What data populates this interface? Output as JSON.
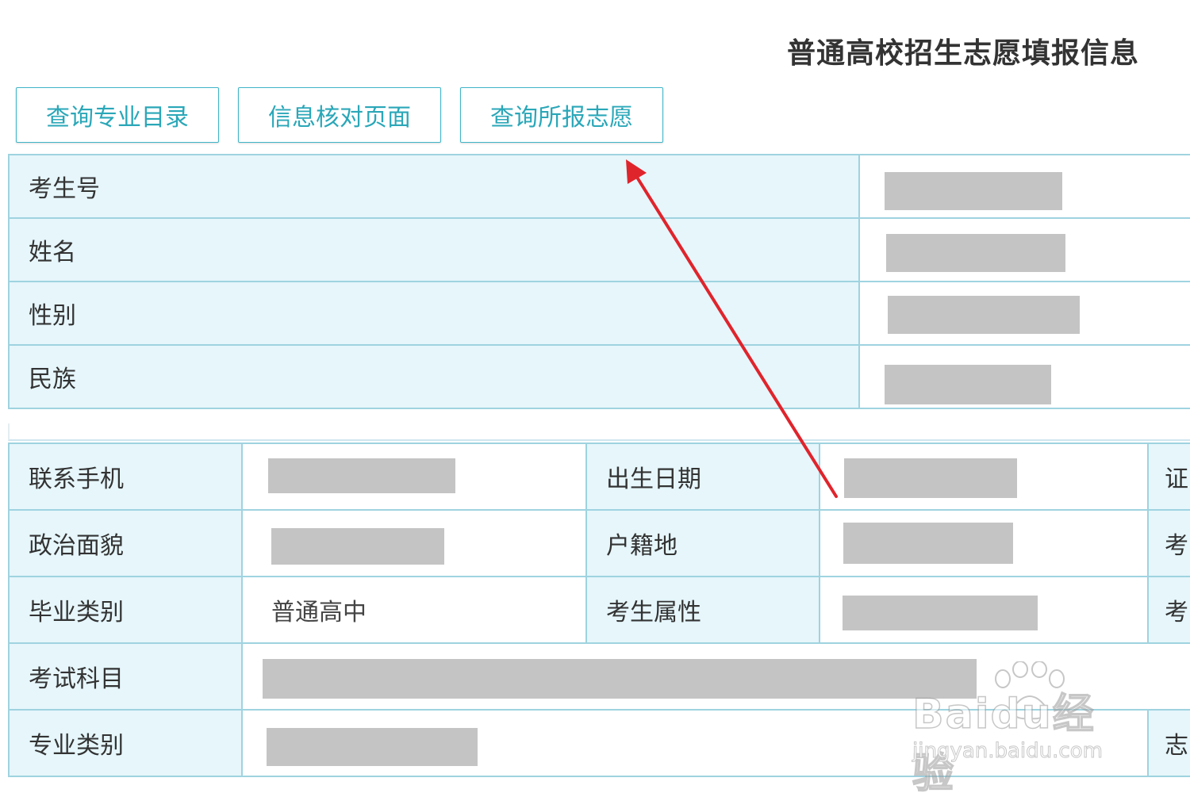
{
  "header": {
    "title": "普通高校招生志愿填报信息"
  },
  "buttons": {
    "query_major": "查询专业目录",
    "info_check": "信息核对页面",
    "query_choices": "查询所报志愿"
  },
  "basic_info": {
    "rows": [
      {
        "label": "考生号"
      },
      {
        "label": "姓名"
      },
      {
        "label": "性别"
      },
      {
        "label": "民族"
      }
    ]
  },
  "details": {
    "phone_label": "联系手机",
    "birth_label": "出生日期",
    "political_label": "政治面貌",
    "hukou_label": "户籍地",
    "grad_type_label": "毕业类别",
    "grad_type_value": "普通高中",
    "attr_label": "考生属性",
    "subjects_label": "考试科目",
    "major_type_label": "专业类别",
    "right_col_row1": "证",
    "right_col_row2": "考",
    "right_col_row3": "考",
    "right_col_row5": "志"
  },
  "watermark": {
    "brand": "Baidu经验",
    "url": "jingyan.baidu.com"
  },
  "colors": {
    "accent": "#2aa7b8",
    "label_bg": "#e6f6fb",
    "border": "#9fd3e0",
    "redaction": "#c4c4c4",
    "arrow": "#e0242c"
  }
}
